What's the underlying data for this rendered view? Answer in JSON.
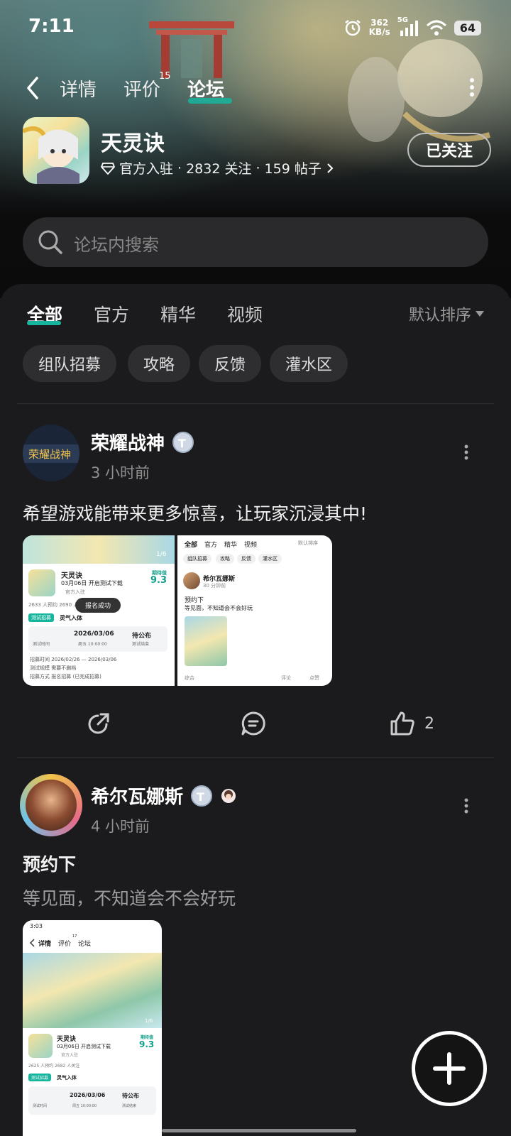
{
  "status": {
    "time": "7:11",
    "speed_value": "362",
    "speed_unit": "KB/s",
    "network": "5G",
    "battery": "64"
  },
  "nav": {
    "tabs": [
      "详情",
      "评价",
      "论坛"
    ],
    "review_count": "15",
    "active_tab": "论坛"
  },
  "app": {
    "name": "天灵诀",
    "badge": "官方入驻",
    "followers": "2832 关注",
    "posts": "159 帖子",
    "follow_label": "已关注"
  },
  "search": {
    "placeholder": "论坛内搜索"
  },
  "forum": {
    "tabs": [
      "全部",
      "官方",
      "精华",
      "视频"
    ],
    "sort": "默认排序",
    "chips": [
      "组队招募",
      "攻略",
      "反馈",
      "灌水区"
    ]
  },
  "posts": [
    {
      "author": "荣耀战神",
      "time": "3 小时前",
      "text": "希望游戏能带来更多惊喜，让玩家沉浸其中!",
      "likes": "2",
      "thumb1": {
        "page_indicator": "1/6",
        "game": "天灵诀",
        "date_line": "03月06日 开启测试下载",
        "official": "官方入驻",
        "score_label": "期待值",
        "score": "9.3",
        "stats": "2633 人预约  2690 人关",
        "tag": "测试招募",
        "line": "灵气入体",
        "toast": "报名成功",
        "test_label": "测试时间",
        "test_date": "2026/03/06",
        "test_time": "周五 10:00:00",
        "test_tbd": "待公布",
        "test_end": "测试结束",
        "rows": [
          "招募时间   2026/02/26 — 2026/03/06",
          "测试规模   需要不删档",
          "招募方式   报名招募 (已完成招募)"
        ]
      },
      "thumb2": {
        "tabs": [
          "全部",
          "官方",
          "精华",
          "视频"
        ],
        "sort": "默认排序",
        "chips": [
          "组队招募",
          "攻略",
          "反馈",
          "灌水区"
        ],
        "author": "希尔瓦娜斯",
        "time": "30 分钟前",
        "title": "预约下",
        "text": "等见面，不知道会不会好玩",
        "footer_left": "综合",
        "comment": "评论",
        "like": "点赞"
      }
    },
    {
      "author": "希尔瓦娜斯",
      "time": "4 小时前",
      "title": "预约下",
      "text": "等见面，不知道会不会好玩",
      "thumb": {
        "time": "3:03",
        "tabs": [
          "详情",
          "评价",
          "论坛"
        ],
        "tab_badge": "17",
        "game": "天灵诀",
        "date_line": "03月06日 开启测试下载",
        "official": "官方入驻",
        "score_label": "期待值",
        "score": "9.3",
        "stats": "2625 人预约  2682 人关注",
        "tag": "测试招募",
        "line": "灵气入体",
        "page_indicator": "1/6",
        "test_label": "测试时间",
        "test_date": "2026/03/06",
        "test_time": "周五 10:00:00",
        "test_tbd": "待公布",
        "test_end": "测试结束"
      }
    }
  ],
  "colors": {
    "accent": "#16b59d",
    "bg": "#1b1b1d",
    "chip": "#2e2e30"
  }
}
